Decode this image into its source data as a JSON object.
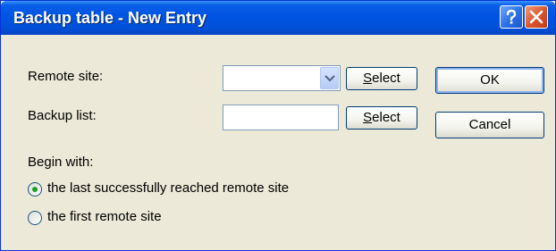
{
  "window": {
    "title": "Backup table - New Entry",
    "help_icon": "question-icon",
    "close_icon": "close-icon"
  },
  "form": {
    "remote_site_label": "Remote site:",
    "remote_site_value": "",
    "backup_list_label": "Backup list:",
    "backup_list_value": "",
    "select_label": "Select",
    "begin_with_label": "Begin with:",
    "options": [
      {
        "label": "the last successfully reached remote site",
        "selected": true
      },
      {
        "label": "the first remote site",
        "selected": false
      }
    ]
  },
  "buttons": {
    "ok": "OK",
    "cancel": "Cancel"
  },
  "colors": {
    "titlebar": "#0054e3",
    "close": "#d9532b",
    "radio_dot": "#21a121"
  }
}
